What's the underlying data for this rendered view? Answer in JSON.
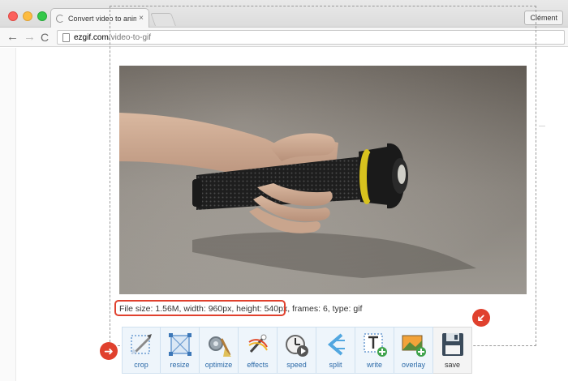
{
  "browser": {
    "tab_title": "Convert video to animated GIF",
    "tab_close": "×",
    "profile_name": "Clément",
    "url_host": "ezgif.com",
    "url_path": "/video-to-gif",
    "back_glyph": "←",
    "forward_glyph": "→",
    "reload_glyph": "C"
  },
  "page": {
    "file_info": "File size: 1.56M, width: 960px, height: 540px, frames: 6, type: gif",
    "badge_glyph": "➜",
    "tools": [
      {
        "label": "crop",
        "icon": "crop-icon"
      },
      {
        "label": "resize",
        "icon": "resize-icon"
      },
      {
        "label": "optimize",
        "icon": "optimize-icon"
      },
      {
        "label": "effects",
        "icon": "effects-icon"
      },
      {
        "label": "speed",
        "icon": "speed-icon"
      },
      {
        "label": "split",
        "icon": "split-icon"
      },
      {
        "label": "write",
        "icon": "write-icon"
      },
      {
        "label": "overlay",
        "icon": "overlay-icon"
      },
      {
        "label": "save",
        "icon": "save-icon"
      }
    ]
  },
  "colors": {
    "accent_red": "#e0412e",
    "tool_label_blue": "#2c6aa8"
  }
}
